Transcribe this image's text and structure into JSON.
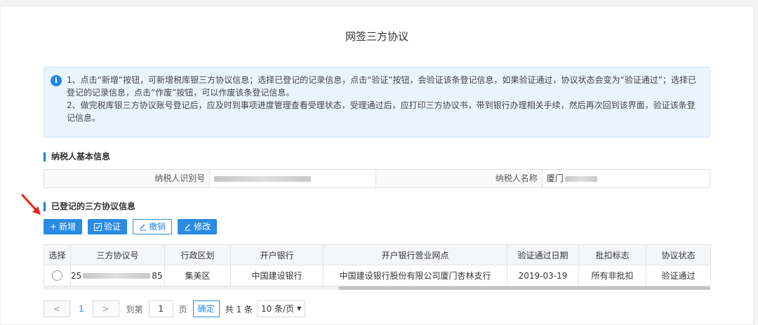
{
  "page": {
    "title": "网签三方协议"
  },
  "notice": {
    "icon": "info-icon",
    "line1": "1、点击“新增”按钮，可新增税库银三方协议信息；选择已登记的记录信息，点击“验证”按钮，会验证该条登记信息，如果验证通过，协议状态会变为“验证通过”；选择已登记的记录信息，点击“作废”按钮，可以作废该条登记信息。",
    "line2": "2、做完税库银三方协议账号登记后，应及时到事项进度管理查看受理状态，受理通过后，应打印三方协议书，带到银行办理相关手续，然后再次回到该界面，验证该条登记信息。"
  },
  "taxpayer": {
    "section_title": "纳税人基本信息",
    "id_label": "纳税人识别号",
    "name_label": "纳税人名称",
    "name_value_visible": "厦门"
  },
  "agreements": {
    "section_title": "已登记的三方协议信息",
    "buttons": {
      "add": "新增",
      "verify": "验证",
      "revoke": "撤销",
      "modify": "修改"
    },
    "columns": [
      "选择",
      "三方协议号",
      "行政区划",
      "开户银行",
      "开户银行营业网点",
      "验证通过日期",
      "批扣标志",
      "协议状态"
    ],
    "rows": [
      {
        "agreement_no_prefix": "25",
        "agreement_no_suffix": "85",
        "district": "集美区",
        "bank": "中国建设银行",
        "branch": "中国建设银行股份有限公司厦门杏林支行",
        "verified_date": "2019-03-19",
        "deduct_flag": "所有非批扣",
        "status": "验证通过"
      }
    ]
  },
  "pager": {
    "prev": "<",
    "next": ">",
    "current_page": "1",
    "goto_label": "到第",
    "page_input": "1",
    "page_unit": "页",
    "confirm": "确定",
    "total": "共 1 条",
    "page_size": "10 条/页"
  },
  "colors": {
    "accent": "#2a8be3",
    "notice_bg": "#eaf4fe",
    "arrow": "#e8231b"
  }
}
